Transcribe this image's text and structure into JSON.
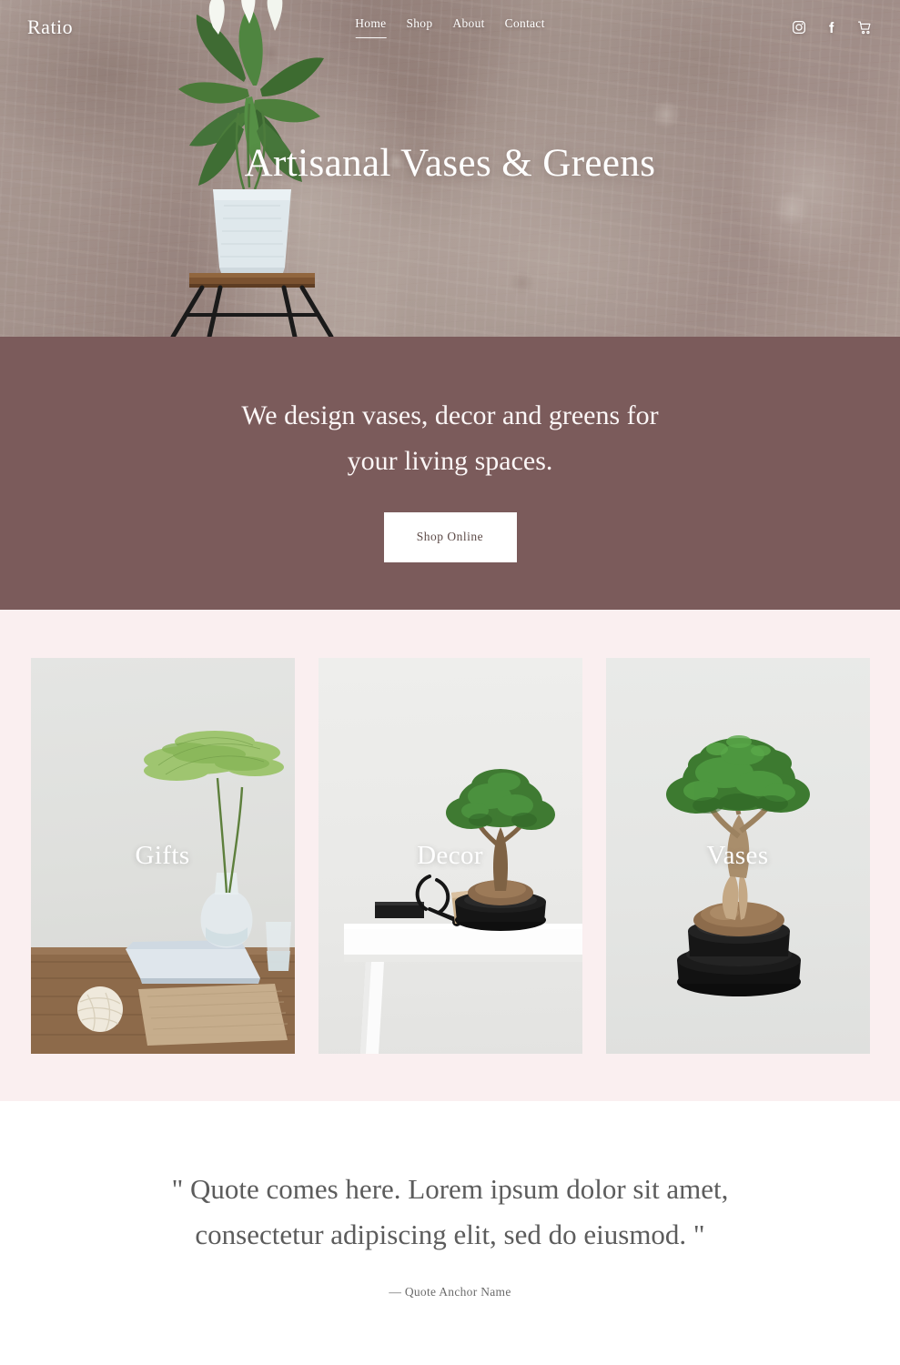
{
  "header": {
    "logo": "Ratio",
    "nav": [
      {
        "label": "Home",
        "active": true
      },
      {
        "label": "Shop",
        "active": false
      },
      {
        "label": "About",
        "active": false
      },
      {
        "label": "Contact",
        "active": false
      }
    ],
    "social": [
      {
        "name": "instagram-icon"
      },
      {
        "name": "facebook-icon"
      },
      {
        "name": "cart-icon"
      }
    ]
  },
  "hero": {
    "title": "Artisanal Vases & Greens",
    "background": "weathered-plaster-wall-with-potted-peace-lily-on-stool"
  },
  "promo": {
    "text": "We design vases, decor and greens for your living spaces.",
    "line1": "We design vases, decor and greens for",
    "line2": "your living spaces.",
    "cta_label": "Shop Online",
    "background_color": "#7b5b5b"
  },
  "categories": {
    "background_color": "#faeff0",
    "items": [
      {
        "label": "Gifts",
        "image": "green-sprig-in-glass-vase-on-wooden-desk"
      },
      {
        "label": "Decor",
        "image": "bonsai-tree-on-white-office-desk"
      },
      {
        "label": "Vases",
        "image": "bonsai-tree-in-black-ceramic-pot"
      }
    ]
  },
  "quote": {
    "line1": "\" Quote comes here. Lorem ipsum dolor sit amet,",
    "line2": "consectetur adipiscing elit, sed do eiusmod. \"",
    "author": "— Quote Anchor Name"
  },
  "theme": {
    "accent": "#7b5b5b",
    "soft_pink": "#faeff0",
    "text_light": "#ffffff",
    "quote_text": "#5c5c5c"
  }
}
